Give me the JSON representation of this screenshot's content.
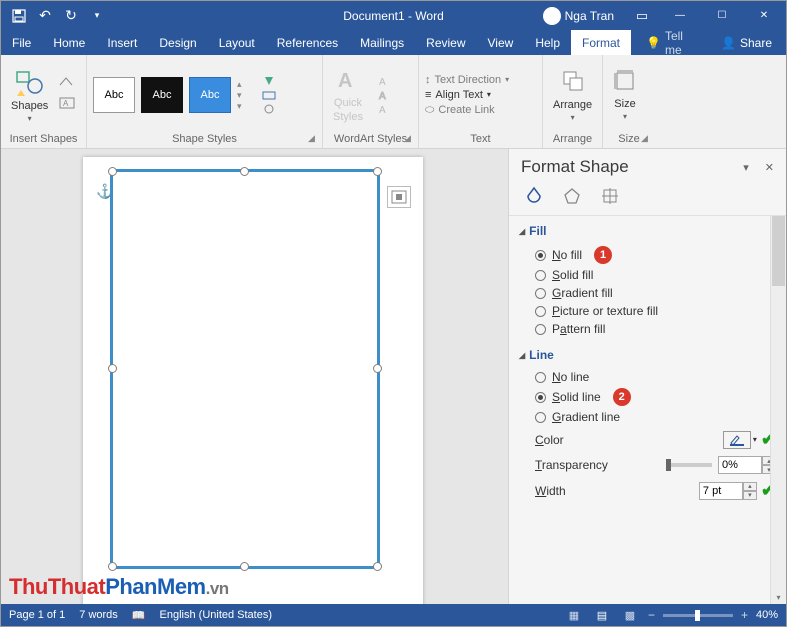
{
  "titlebar": {
    "doc_title": "Document1 - Word",
    "user_name": "Nga Tran"
  },
  "tabs": {
    "file": "File",
    "home": "Home",
    "insert": "Insert",
    "design": "Design",
    "layout": "Layout",
    "references": "References",
    "mailings": "Mailings",
    "review": "Review",
    "view": "View",
    "help": "Help",
    "format": "Format",
    "tellme": "Tell me",
    "share": "Share"
  },
  "ribbon": {
    "insert_shapes": {
      "label": "Insert Shapes",
      "shapes_btn": "Shapes"
    },
    "shape_styles": {
      "label": "Shape Styles",
      "swatch": "Abc"
    },
    "wordart": {
      "label": "WordArt Styles",
      "quick": "Quick",
      "styles": "Styles"
    },
    "text": {
      "label": "Text",
      "dir": "Text Direction",
      "align": "Align Text",
      "link": "Create Link"
    },
    "arrange": {
      "label": "Arrange",
      "btn": "Arrange"
    },
    "size": {
      "label": "Size",
      "btn": "Size"
    }
  },
  "pane": {
    "title": "Format Shape",
    "fill": {
      "heading": "Fill",
      "no_fill": "No fill",
      "solid_fill": "Solid fill",
      "gradient_fill": "Gradient fill",
      "picture_fill": "Picture or texture fill",
      "pattern_fill": "Pattern fill"
    },
    "line": {
      "heading": "Line",
      "no_line": "No line",
      "solid_line": "Solid line",
      "gradient_line": "Gradient line",
      "color": "Color",
      "transparency": "Transparency",
      "transparency_val": "0%",
      "width": "Width",
      "width_val": "7 pt"
    },
    "callouts": {
      "one": "1",
      "two": "2"
    }
  },
  "status": {
    "page": "Page 1 of 1",
    "words": "7 words",
    "lang": "English (United States)",
    "zoom": "40%"
  },
  "watermark": {
    "a": "ThuThuat",
    "b": "PhanMem",
    "c": ".vn"
  }
}
